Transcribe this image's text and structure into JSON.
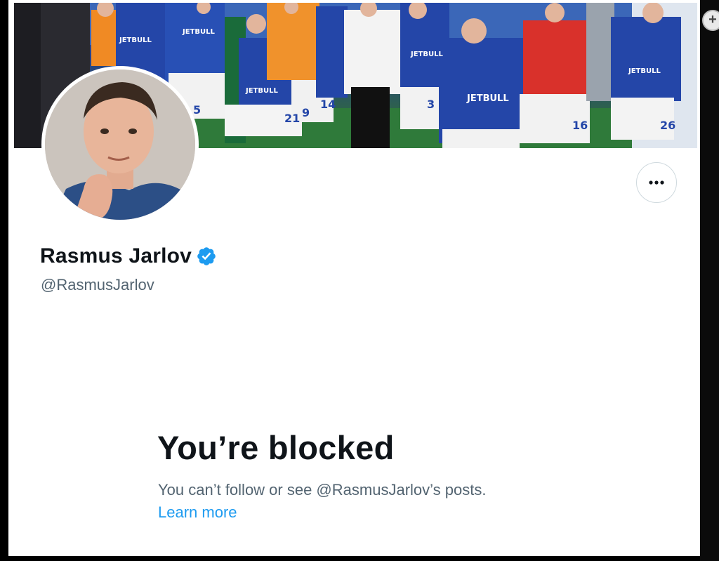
{
  "profile": {
    "display_name": "Rasmus Jarlov",
    "handle": "@RasmusJarlov",
    "verified": true
  },
  "banner": {
    "sponsor_text": "JETBULL",
    "jersey_numbers": [
      "5",
      "21",
      "9",
      "14",
      "3",
      "16",
      "26"
    ]
  },
  "blocked": {
    "title": "You’re blocked",
    "description": "You can’t follow or see @RasmusJarlov’s posts.",
    "link_label": "Learn more"
  },
  "icons": {
    "verified": "verified-badge-icon",
    "more": "more-options-icon",
    "zoom": "zoom-in-icon"
  },
  "colors": {
    "accent": "#1d9bf0",
    "text_primary": "#0f1419",
    "text_secondary": "#536471",
    "jersey_blue": "#2446a8"
  }
}
